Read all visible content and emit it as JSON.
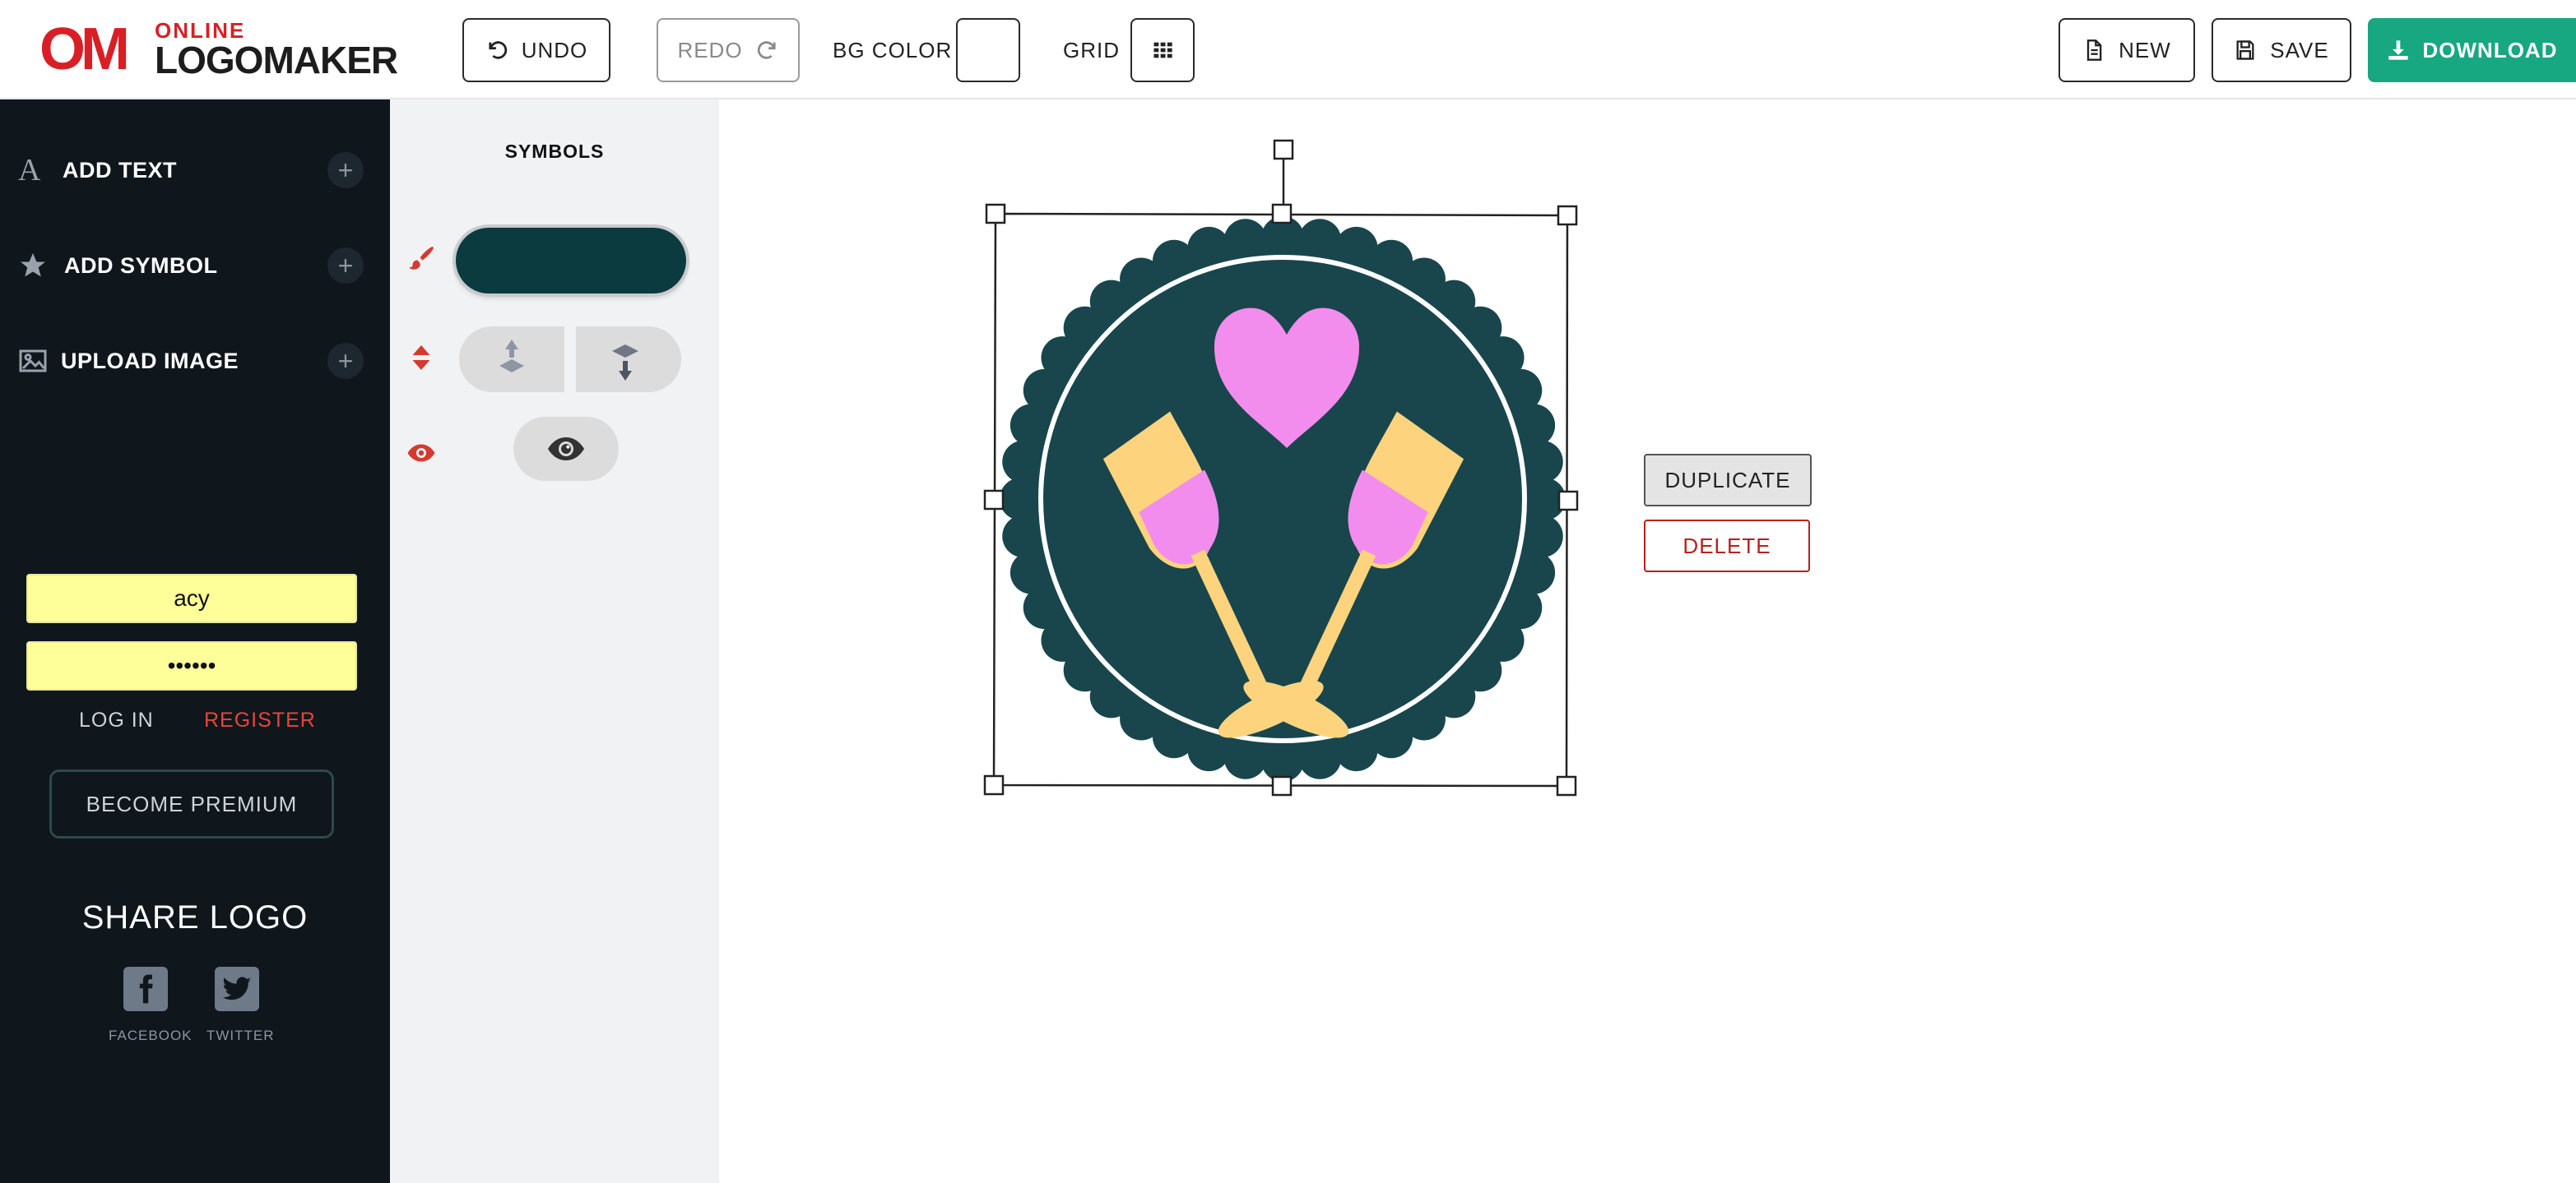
{
  "brand": {
    "mark": "OM",
    "online": "ONLINE",
    "word": "LOGOMAKER",
    "accent": "#d91f26"
  },
  "toolbar": {
    "undo_label": "UNDO",
    "redo_label": "REDO",
    "bg_color_label": "BG COLOR",
    "grid_label": "GRID",
    "new_label": "NEW",
    "save_label": "SAVE",
    "download_label": "DOWNLOAD",
    "download_color": "#17a781"
  },
  "sidebar": {
    "items": [
      {
        "label": "ADD TEXT",
        "icon": "text-icon"
      },
      {
        "label": "ADD SYMBOL",
        "icon": "star-icon"
      },
      {
        "label": "UPLOAD IMAGE",
        "icon": "image-icon"
      }
    ],
    "username_value": "acy",
    "password_value": "••••••",
    "login_label": "LOG IN",
    "register_label": "REGISTER",
    "premium_label": "BECOME PREMIUM",
    "share_title": "SHARE LOGO",
    "facebook_label": "FACEBOOK",
    "twitter_label": "TWITTER"
  },
  "panel": {
    "title": "SYMBOLS",
    "symbol_color": "#0b3a3f",
    "icons": [
      "paint-brush-icon",
      "layer-order-icon",
      "eye-icon"
    ]
  },
  "canvas": {
    "duplicate_label": "DUPLICATE",
    "delete_label": "DELETE",
    "badge_color": "#18464c",
    "heart_color": "#f28ced",
    "glass_color": "#fdd47d"
  }
}
